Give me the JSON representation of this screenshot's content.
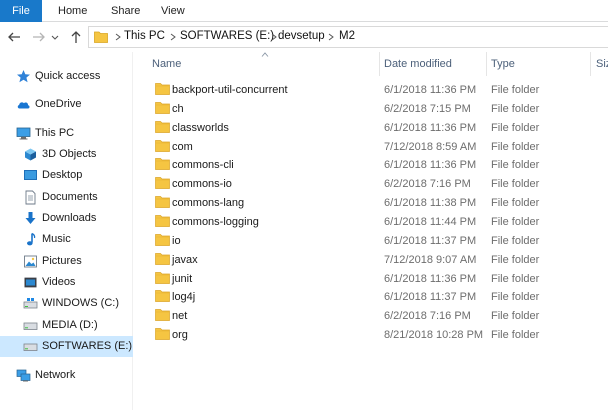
{
  "ribbon": {
    "tabs": [
      "File",
      "Home",
      "Share",
      "View"
    ]
  },
  "address": {
    "crumbs": [
      "This PC",
      "SOFTWARES (E:)",
      "devsetup",
      "M2"
    ]
  },
  "navpane": {
    "items": [
      {
        "label": "Quick access",
        "icon": "star-icon"
      },
      {
        "label": "OneDrive",
        "icon": "cloud-icon"
      },
      {
        "label": "This PC",
        "icon": "computer-icon"
      },
      {
        "label": "3D Objects",
        "icon": "cube-icon"
      },
      {
        "label": "Desktop",
        "icon": "desktop-icon"
      },
      {
        "label": "Documents",
        "icon": "document-icon"
      },
      {
        "label": "Downloads",
        "icon": "download-arrow-icon"
      },
      {
        "label": "Music",
        "icon": "music-note-icon"
      },
      {
        "label": "Pictures",
        "icon": "picture-icon"
      },
      {
        "label": "Videos",
        "icon": "film-icon"
      },
      {
        "label": "WINDOWS (C:)",
        "icon": "windows-drive-icon"
      },
      {
        "label": "MEDIA (D:)",
        "icon": "drive-icon"
      },
      {
        "label": "SOFTWARES (E:)",
        "icon": "drive-icon"
      },
      {
        "label": "Network",
        "icon": "network-icon"
      }
    ],
    "selected": "SOFTWARES (E:)"
  },
  "columns": [
    "Name",
    "Date modified",
    "Type",
    "Siz"
  ],
  "files": [
    {
      "name": "backport-util-concurrent",
      "date": "6/1/2018 11:36 PM",
      "type": "File folder"
    },
    {
      "name": "ch",
      "date": "6/2/2018 7:15 PM",
      "type": "File folder"
    },
    {
      "name": "classworlds",
      "date": "6/1/2018 11:36 PM",
      "type": "File folder"
    },
    {
      "name": "com",
      "date": "7/12/2018 8:59 AM",
      "type": "File folder"
    },
    {
      "name": "commons-cli",
      "date": "6/1/2018 11:36 PM",
      "type": "File folder"
    },
    {
      "name": "commons-io",
      "date": "6/2/2018 7:16 PM",
      "type": "File folder"
    },
    {
      "name": "commons-lang",
      "date": "6/1/2018 11:38 PM",
      "type": "File folder"
    },
    {
      "name": "commons-logging",
      "date": "6/1/2018 11:44 PM",
      "type": "File folder"
    },
    {
      "name": "io",
      "date": "6/1/2018 11:37 PM",
      "type": "File folder"
    },
    {
      "name": "javax",
      "date": "7/12/2018 9:07 AM",
      "type": "File folder"
    },
    {
      "name": "junit",
      "date": "6/1/2018 11:36 PM",
      "type": "File folder"
    },
    {
      "name": "log4j",
      "date": "6/1/2018 11:37 PM",
      "type": "File folder"
    },
    {
      "name": "net",
      "date": "6/2/2018 7:16 PM",
      "type": "File folder"
    },
    {
      "name": "org",
      "date": "8/21/2018 10:28 PM",
      "type": "File folder"
    }
  ],
  "colors": {
    "file_tab": "#1979ca",
    "selection": "#cce8ff",
    "folder": "#f5c542",
    "header_text": "#4c607a"
  }
}
